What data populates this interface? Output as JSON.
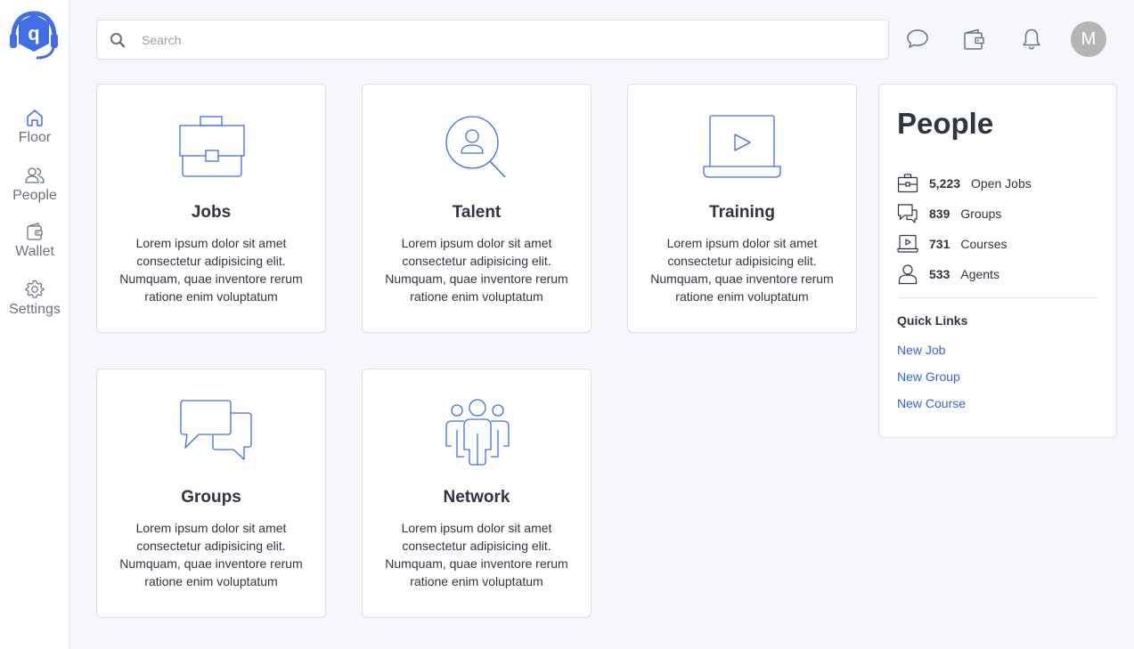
{
  "brand": {
    "logo_letter": "q",
    "accent": "#3f6ee8"
  },
  "sidebar": {
    "items": [
      {
        "label": "Floor",
        "icon": "home-icon"
      },
      {
        "label": "People",
        "icon": "users-icon"
      },
      {
        "label": "Wallet",
        "icon": "wallet-icon"
      },
      {
        "label": "Settings",
        "icon": "gear-icon"
      }
    ]
  },
  "header": {
    "search_placeholder": "Search",
    "search_value": "",
    "avatar_initial": "M"
  },
  "cards": [
    {
      "title": "Jobs",
      "icon": "briefcase-icon",
      "text": "Lorem ipsum dolor sit amet consectetur adipisicing elit. Numquam, quae inventore rerum ratione enim voluptatum"
    },
    {
      "title": "Talent",
      "icon": "person-search-icon",
      "text": "Lorem ipsum dolor sit amet consectetur adipisicing elit. Numquam, quae inventore rerum ratione enim voluptatum"
    },
    {
      "title": "Training",
      "icon": "laptop-play-icon",
      "text": "Lorem ipsum dolor sit amet consectetur adipisicing elit. Numquam, quae inventore rerum ratione enim voluptatum"
    },
    {
      "title": "Groups",
      "icon": "chat-bubbles-icon",
      "text": "Lorem ipsum dolor sit amet consectetur adipisicing elit. Numquam, quae inventore rerum ratione enim voluptatum"
    },
    {
      "title": "Network",
      "icon": "network-icon",
      "text": "Lorem ipsum dolor sit amet consectetur adipisicing elit. Numquam, quae inventore rerum ratione enim voluptatum"
    }
  ],
  "panel": {
    "title": "People",
    "stats": [
      {
        "value": "5,223",
        "label": "Open Jobs",
        "icon": "briefcase-icon"
      },
      {
        "value": "839",
        "label": "Groups",
        "icon": "chat-bubbles-icon"
      },
      {
        "value": "731",
        "label": "Courses",
        "icon": "laptop-play-icon"
      },
      {
        "value": "533",
        "label": "Agents",
        "icon": "person-icon"
      }
    ],
    "quick_links_title": "Quick Links",
    "quick_links": [
      "New Job",
      "New Group",
      "New Course"
    ]
  }
}
